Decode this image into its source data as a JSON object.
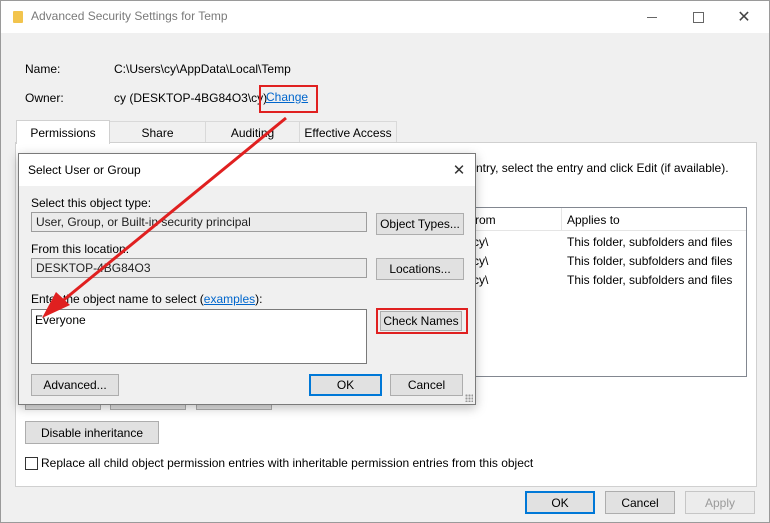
{
  "window": {
    "title": "Advanced Security Settings for Temp",
    "name_label": "Name:",
    "name_value": "C:\\Users\\cy\\AppData\\Local\\Temp",
    "owner_label": "Owner:",
    "owner_value": "cy (DESKTOP-4BG84O3\\cy)",
    "change_link": "Change",
    "close_glyph": "✕"
  },
  "tabs": [
    {
      "label": "Permissions"
    },
    {
      "label": "Share"
    },
    {
      "label": "Auditing"
    },
    {
      "label": "Effective Access"
    }
  ],
  "permissions": {
    "instruction_fragment": "ntry, select the entry and click Edit (if available).",
    "columns": {
      "from": "rom",
      "applies_to": "Applies to"
    },
    "rows": [
      {
        "from": "cy\\",
        "applies_to": "This folder, subfolders and files"
      },
      {
        "from": "cy\\",
        "applies_to": "This folder, subfolders and files"
      },
      {
        "from": "cy\\",
        "applies_to": "This folder, subfolders and files"
      }
    ],
    "disable_inheritance": "Disable inheritance",
    "replace_label": "Replace all child object permission entries with inheritable permission entries from this object"
  },
  "footer": {
    "ok": "OK",
    "cancel": "Cancel",
    "apply": "Apply"
  },
  "dialog": {
    "title": "Select User or Group",
    "close_glyph": "✕",
    "object_type_label": "Select this object type:",
    "object_type_value": "User, Group, or Built-in security principal",
    "object_types_button": "Object Types...",
    "location_label": "From this location:",
    "location_value": "DESKTOP-4BG84O3",
    "locations_button": "Locations...",
    "enter_label_prefix": "Enter the object name to select (",
    "examples_link": "examples",
    "enter_label_suffix": "):",
    "object_name_value": "Everyone",
    "check_names_button": "Check Names",
    "advanced_button": "Advanced...",
    "ok_button": "OK",
    "cancel_button": "Cancel"
  },
  "colors": {
    "annotation": "#e02020",
    "link": "#0066cc",
    "focus": "#0078d7"
  }
}
